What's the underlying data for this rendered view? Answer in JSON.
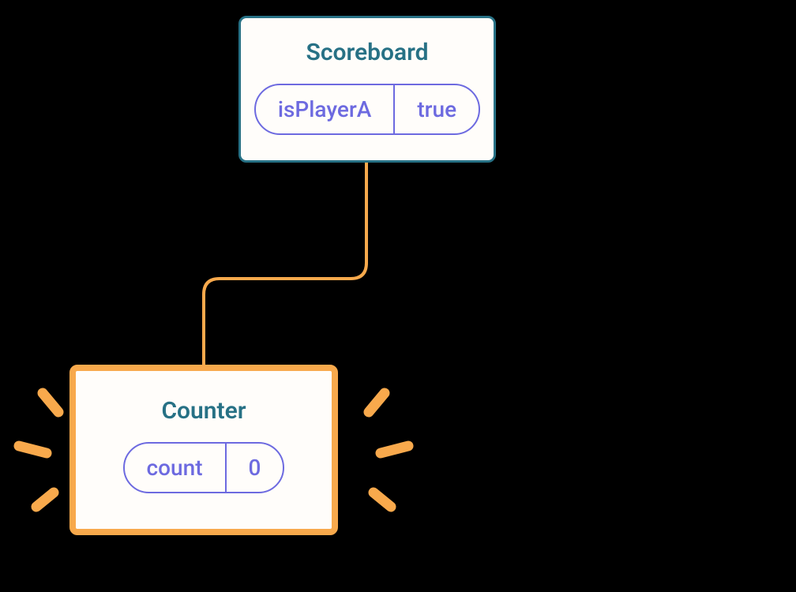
{
  "parent": {
    "title": "Scoreboard",
    "state_key": "isPlayerA",
    "state_value": "true"
  },
  "child": {
    "title": "Counter",
    "state_key": "count",
    "state_value": "0"
  }
}
